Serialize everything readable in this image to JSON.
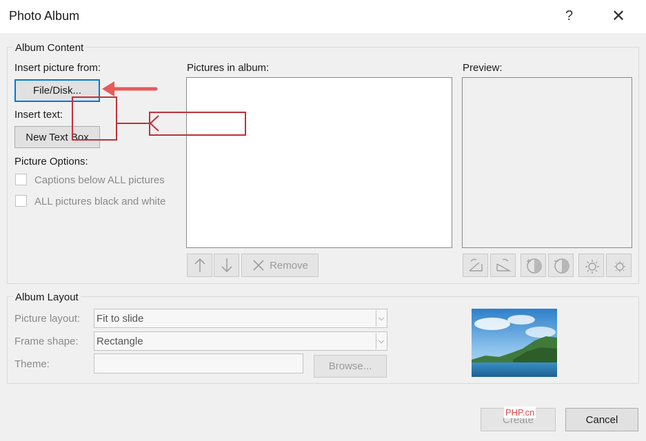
{
  "window": {
    "title": "Photo Album",
    "help": "?",
    "close": "✕"
  },
  "album_content": {
    "legend": "Album Content",
    "insert_picture_from": "Insert picture from:",
    "file_disk_button": "File/Disk...",
    "insert_text": "Insert text:",
    "new_text_box_button": "New Text Box",
    "picture_options": "Picture Options:",
    "captions_option": "Captions below ALL pictures",
    "black_white_option": "ALL pictures black and white",
    "pictures_in_album": "Pictures in album:",
    "remove_button": "Remove",
    "preview_label": "Preview:"
  },
  "album_layout": {
    "legend": "Album Layout",
    "picture_layout_label": "Picture layout:",
    "picture_layout_value": "Fit to slide",
    "frame_shape_label": "Frame shape:",
    "frame_shape_value": "Rectangle",
    "theme_label": "Theme:",
    "theme_value": "",
    "browse_button": "Browse..."
  },
  "footer": {
    "create_button": "Create",
    "cancel_button": "Cancel",
    "watermark": "PHP.cn"
  },
  "colors": {
    "annotation_red": "#c0303a",
    "arrow_red": "#e65a5a",
    "accent_blue": "#0078d7"
  }
}
